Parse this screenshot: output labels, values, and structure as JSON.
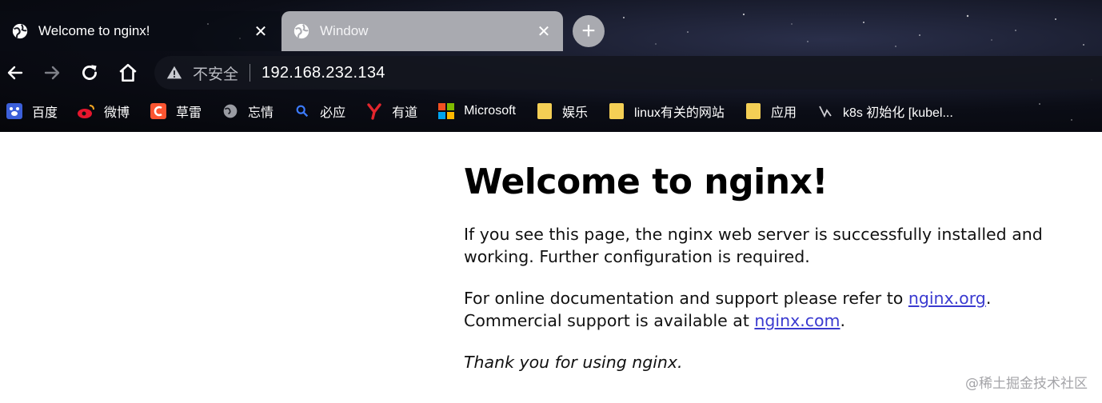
{
  "tabs": [
    {
      "title": "Welcome to nginx!",
      "active": true,
      "icon": "globe-icon"
    },
    {
      "title": "Window",
      "active": false,
      "icon": "globe-icon"
    }
  ],
  "tab_close_glyph": "✕",
  "new_tab_glyph": "+",
  "toolbar": {
    "security_label": "不安全",
    "url": "192.168.232.134"
  },
  "bookmarks": [
    {
      "label": "百度",
      "icon": "baidu-icon",
      "color": "#3b5fd9"
    },
    {
      "label": "微博",
      "icon": "weibo-icon",
      "color": "#e6162d"
    },
    {
      "label": "草雷",
      "icon": "csdn-icon",
      "color": "#fc5531"
    },
    {
      "label": "忘情",
      "icon": "globe-icon",
      "color": "#9a9ca3"
    },
    {
      "label": "必应",
      "icon": "bing-search-icon",
      "color": "#3c7bff"
    },
    {
      "label": "有道",
      "icon": "youdao-icon",
      "color": "#e3262d"
    },
    {
      "label": "Microsoft",
      "icon": "microsoft-icon",
      "color": "#f25022"
    },
    {
      "label": "娱乐",
      "icon": "folder-icon",
      "color": "#f4cf55"
    },
    {
      "label": "linux有关的网站",
      "icon": "folder-icon",
      "color": "#f4cf55"
    },
    {
      "label": "应用",
      "icon": "folder-icon",
      "color": "#f4cf55"
    },
    {
      "label": "k8s 初始化 [kubel...",
      "icon": "k8s-icon",
      "color": "#cfcfd4"
    }
  ],
  "page": {
    "heading": "Welcome to nginx!",
    "p1": "If you see this page, the nginx web server is successfully installed and working. Further configuration is required.",
    "p2_before": "For online documentation and support please refer to ",
    "p2_link1": "nginx.org",
    "p2_mid": ".",
    "p2_line2": "Commercial support is available at ",
    "p2_link2": "nginx.com",
    "p2_end": ".",
    "p3": "Thank you for using nginx."
  },
  "watermark": "@稀土掘金技术社区"
}
